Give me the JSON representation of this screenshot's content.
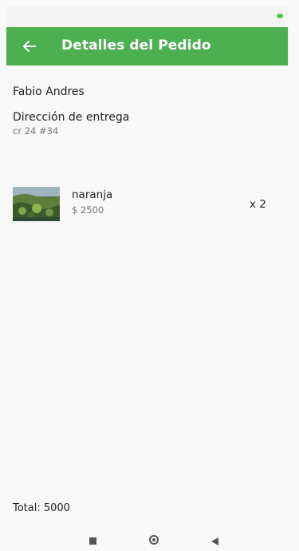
{
  "app_bar": {
    "title": "Detalles del Pedido",
    "back_icon": "arrow-back-icon",
    "color": "#4caf50"
  },
  "order": {
    "customer_name": "Fabio Andres",
    "address_label": "Dirección de entrega",
    "address_value": "cr 24 #34"
  },
  "items": [
    {
      "name": "naranja",
      "price": "$ 2500",
      "quantity": "x 2",
      "thumbnail_icon": "product-image"
    }
  ],
  "total": "Total: 5000",
  "nav": {
    "recents_icon": "square-icon",
    "home_icon": "circle-icon",
    "back_icon": "triangle-back-icon"
  },
  "status_bar": {
    "indicator_color": "#3fcf3f"
  }
}
